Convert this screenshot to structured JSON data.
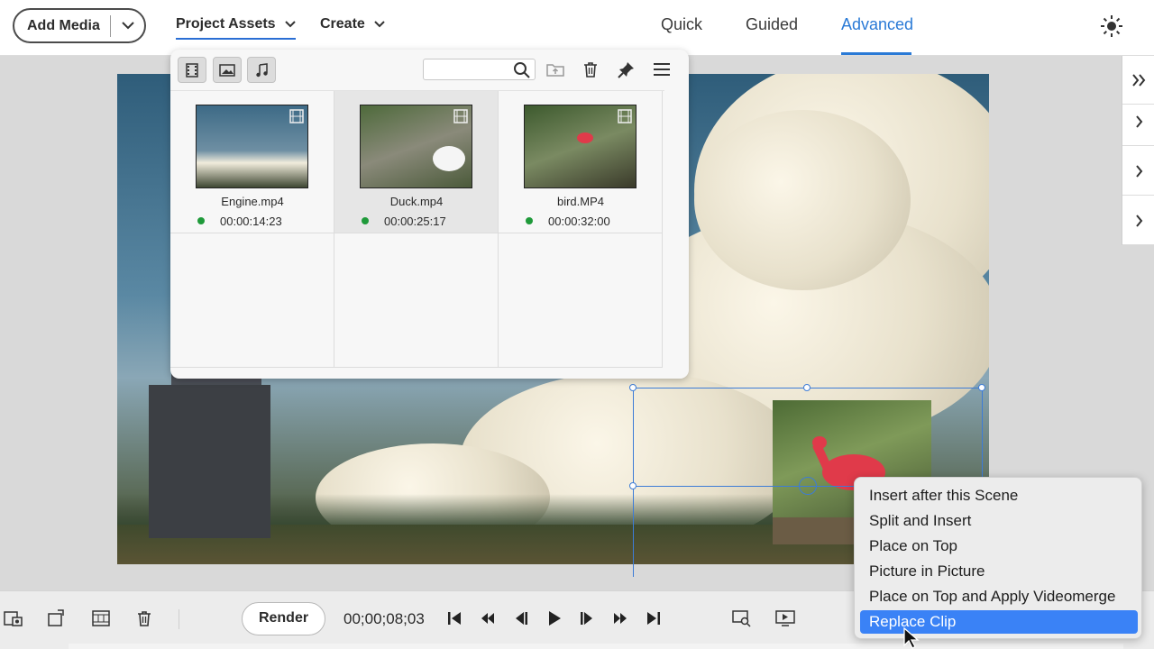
{
  "topbar": {
    "add_media_label": "Add Media",
    "menus": [
      {
        "label": "Project Assets"
      },
      {
        "label": "Create"
      }
    ],
    "modes": [
      {
        "label": "Quick"
      },
      {
        "label": "Guided"
      },
      {
        "label": "Advanced"
      }
    ],
    "active_mode": "Advanced",
    "accent_color": "#2a7ad6"
  },
  "assets_panel": {
    "search_placeholder": "",
    "filters": [
      "video-filter-icon",
      "image-filter-icon",
      "audio-filter-icon"
    ],
    "items": [
      {
        "name": "Engine.mp4",
        "duration": "00:00:14:23",
        "status_color": "#1f9a3a"
      },
      {
        "name": "Duck.mp4",
        "duration": "00:00:25:17",
        "status_color": "#1f9a3a",
        "selected": true
      },
      {
        "name": "bird.MP4",
        "duration": "00:00:32:00",
        "status_color": "#1f9a3a"
      }
    ]
  },
  "context_menu": {
    "items": [
      {
        "label": "Insert after this Scene"
      },
      {
        "label": "Split and Insert"
      },
      {
        "label": "Place on Top"
      },
      {
        "label": "Picture in Picture"
      },
      {
        "label": "Place on Top and Apply Videomerge"
      },
      {
        "label": "Replace Clip",
        "highlighted": true
      }
    ],
    "highlight_color": "#3a82f6"
  },
  "bottombar": {
    "render_label": "Render",
    "timecode": "00;00;08;03"
  }
}
